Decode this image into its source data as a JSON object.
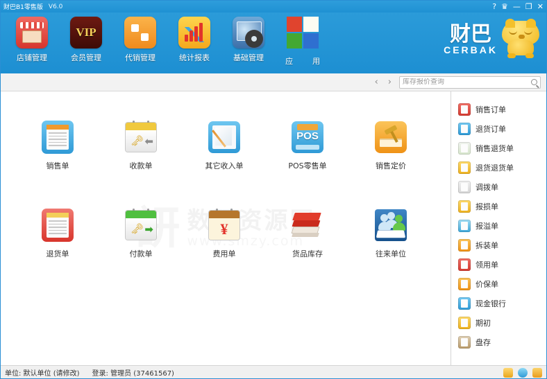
{
  "window": {
    "title": "财巴B1零售版",
    "version": "V6.0",
    "controls": [
      {
        "name": "help-icon",
        "glyph": "?"
      },
      {
        "name": "crown-icon",
        "glyph": "♛"
      },
      {
        "name": "minimize-button",
        "glyph": "—"
      },
      {
        "name": "maximize-button",
        "glyph": "❐"
      },
      {
        "name": "close-button",
        "glyph": "✕"
      }
    ]
  },
  "toolbar": {
    "items": [
      {
        "label": "店铺管理",
        "icon": "shop-icon"
      },
      {
        "label": "会员管理",
        "icon": "vip-icon"
      },
      {
        "label": "代销管理",
        "icon": "consignment-icon"
      },
      {
        "label": "统计报表",
        "icon": "report-icon"
      },
      {
        "label": "基础管理",
        "icon": "settings-icon"
      }
    ],
    "apps_label_left": "应",
    "apps_label_right": "用"
  },
  "brand": {
    "name_cn": "财巴",
    "name_en": "CERBAK"
  },
  "search": {
    "prev_glyph": "‹",
    "next_glyph": "›",
    "placeholder": "库存报价查询",
    "value": "",
    "icon": "search-icon"
  },
  "main": {
    "tiles": [
      {
        "label": "销售单",
        "icon": "sales-order-icon"
      },
      {
        "label": "收款单",
        "icon": "receipt-icon"
      },
      {
        "label": "其它收入单",
        "icon": "other-income-icon"
      },
      {
        "label": "POS零售单",
        "icon": "pos-retail-icon"
      },
      {
        "label": "销售定价",
        "icon": "sales-pricing-icon"
      },
      {
        "label": "退货单",
        "icon": "return-order-icon"
      },
      {
        "label": "付款单",
        "icon": "payment-icon"
      },
      {
        "label": "费用单",
        "icon": "expense-icon"
      },
      {
        "label": "货品库存",
        "icon": "inventory-icon"
      },
      {
        "label": "往来单位",
        "icon": "partners-icon"
      }
    ],
    "pos_text": "POS",
    "yen_symbol": "¥",
    "vip_text": "VIP"
  },
  "watermark": {
    "logo_glyph": "訮",
    "name_cn": "数码资源网",
    "url": "www.smzy.com"
  },
  "sidebar": {
    "items": [
      {
        "label": "销售订单",
        "color": "si-red"
      },
      {
        "label": "退货订单",
        "color": "si-blue"
      },
      {
        "label": "销售退货单",
        "color": "si-green"
      },
      {
        "label": "退货退货单",
        "color": "si-yellow"
      },
      {
        "label": "调拨单",
        "color": "si-gray"
      },
      {
        "label": "报损单",
        "color": "si-yellow"
      },
      {
        "label": "报溢单",
        "color": "si-cyan"
      },
      {
        "label": "拆装单",
        "color": "si-orange"
      },
      {
        "label": "领用单",
        "color": "si-red"
      },
      {
        "label": "价保单",
        "color": "si-orange"
      },
      {
        "label": "现金银行",
        "color": "si-blue"
      },
      {
        "label": "期初",
        "color": "si-yellow"
      },
      {
        "label": "盘存",
        "color": "si-brown"
      }
    ]
  },
  "status": {
    "unit": "单位: 默认单位 (请修改)",
    "login": "登录: 管理员 (37461567)",
    "icons": [
      "shirt-icon",
      "chat-icon",
      "grid-icon"
    ]
  }
}
